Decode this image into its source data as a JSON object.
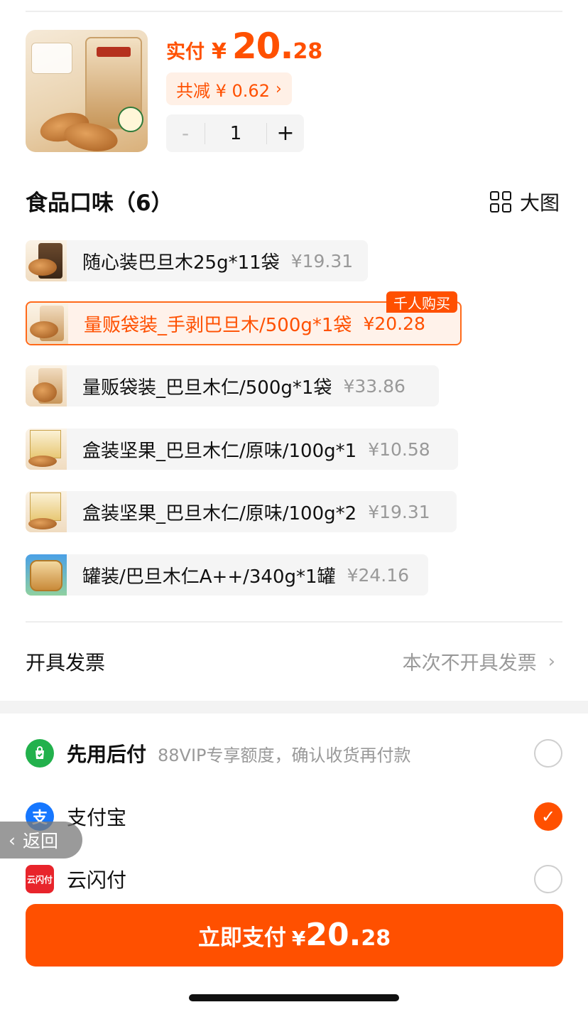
{
  "product": {
    "price_label": "实付",
    "currency": "¥",
    "price_integer": "20.",
    "price_decimal": "28",
    "discount_text": "共减 ¥ 0.62",
    "discount_arrow": "›",
    "quantity": "1",
    "minus": "-",
    "plus": "+"
  },
  "flavor": {
    "title": "食品口味（6）",
    "big_image_label": "大图",
    "badge": "千人购买",
    "skus": [
      {
        "name": "随心装巴旦木25g*11袋",
        "price": "¥19.31",
        "selected": false
      },
      {
        "name": "量贩袋装_手剥巴旦木/500g*1袋",
        "price": "¥20.28",
        "selected": true
      },
      {
        "name": "量贩袋装_巴旦木仁/500g*1袋",
        "price": "¥33.86",
        "selected": false
      },
      {
        "name": "盒装坚果_巴旦木仁/原味/100g*1",
        "price": "¥10.58",
        "selected": false
      },
      {
        "name": "盒装坚果_巴旦木仁/原味/100g*2",
        "price": "¥19.31",
        "selected": false
      },
      {
        "name": "罐装/巴旦木仁A++/340g*1罐",
        "price": "¥24.16",
        "selected": false
      }
    ]
  },
  "invoice": {
    "label": "开具发票",
    "value": "本次不开具发票"
  },
  "payment": {
    "methods": [
      {
        "name": "先用后付",
        "desc": "88VIP专享额度，确认收货再付款",
        "icon": "bag-check-icon",
        "checked": false
      },
      {
        "name": "支付宝",
        "desc": "",
        "icon": "alipay-icon",
        "checked": true
      },
      {
        "name": "云闪付",
        "desc": "",
        "icon": "unionpay-icon",
        "checked": false
      }
    ],
    "alipay_glyph": "支",
    "union_glyph": "云闪付"
  },
  "back_label": "返回",
  "pay_button": {
    "label": "立即支付",
    "currency": "¥",
    "amount_integer": "20.",
    "amount_decimal": "28"
  },
  "colors": {
    "accent": "#ff5000",
    "muted": "#999999",
    "selected_bg": "#fff2ea"
  }
}
